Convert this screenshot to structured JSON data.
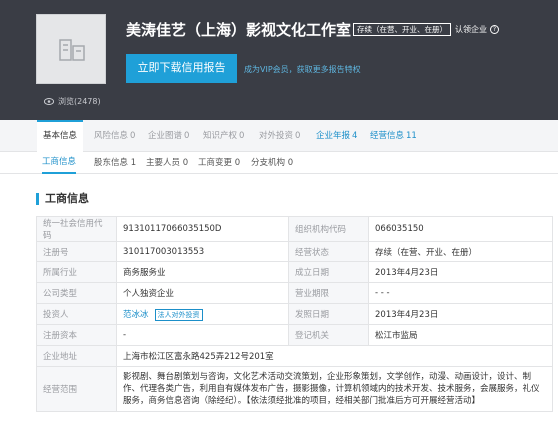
{
  "header": {
    "company_name": "美涛佳艺（上海）影视文化工作室",
    "status_badge": "存续（在营、开业、在册）",
    "certify_label": "认领企业",
    "download_button": "立即下载信用报告",
    "vip_link": "成为VIP会员，获取更多报告特权",
    "views": "浏览(2478)"
  },
  "tabs": [
    {
      "label": "基本信息",
      "count": ""
    },
    {
      "label": "风险信息",
      "count": "0"
    },
    {
      "label": "企业图谱",
      "count": "0"
    },
    {
      "label": "知识产权",
      "count": "0"
    },
    {
      "label": "对外投资",
      "count": "0"
    },
    {
      "label": "企业年报",
      "count": "4"
    },
    {
      "label": "经营信息",
      "count": "11"
    }
  ],
  "subtabs": [
    {
      "label": "工商信息"
    },
    {
      "label": "股东信息 1"
    },
    {
      "label": "主要人员 0"
    },
    {
      "label": "工商变更 0"
    },
    {
      "label": "分支机构 0"
    }
  ],
  "section_title": "工商信息",
  "info": {
    "credit_code_label": "统一社会信用代码",
    "credit_code": "91310117066035150D",
    "org_code_label": "组织机构代码",
    "org_code": "066035150",
    "reg_no_label": "注册号",
    "reg_no": "310117003013553",
    "status_label": "经营状态",
    "status": "存续（在营、开业、在册）",
    "industry_label": "所属行业",
    "industry": "商务服务业",
    "est_date_label": "成立日期",
    "est_date": "2013年4月23日",
    "type_label": "公司类型",
    "type": "个人独资企业",
    "period_label": "营业期限",
    "period": "- - -",
    "investor_label": "投资人",
    "investor": "范冰冰",
    "investor_tag": "法人对外投资",
    "issue_date_label": "发照日期",
    "issue_date": "2013年4月23日",
    "capital_label": "注册资本",
    "capital": "-",
    "authority_label": "登记机关",
    "authority": "松江市监局",
    "address_label": "企业地址",
    "address": "上海市松江区富永路425弄212号201室",
    "scope_label": "经营范围",
    "scope": "影视剧、舞台剧策划与咨询，文化艺术活动交流策划，企业形象策划，文学创作，动漫、动画设计，设计、制作、代理各类广告，利用自有媒体发布广告，摄影摄像，计算机领域内的技术开发、技术服务，会展服务，礼仪服务，商务信息咨询（除经纪）。【依法须经批准的项目，经相关部门批准后方可开展经营活动】"
  },
  "colors": {
    "header_bg": "#3a3d45",
    "accent": "#1fa0d8",
    "link": "#1c8fc9"
  }
}
